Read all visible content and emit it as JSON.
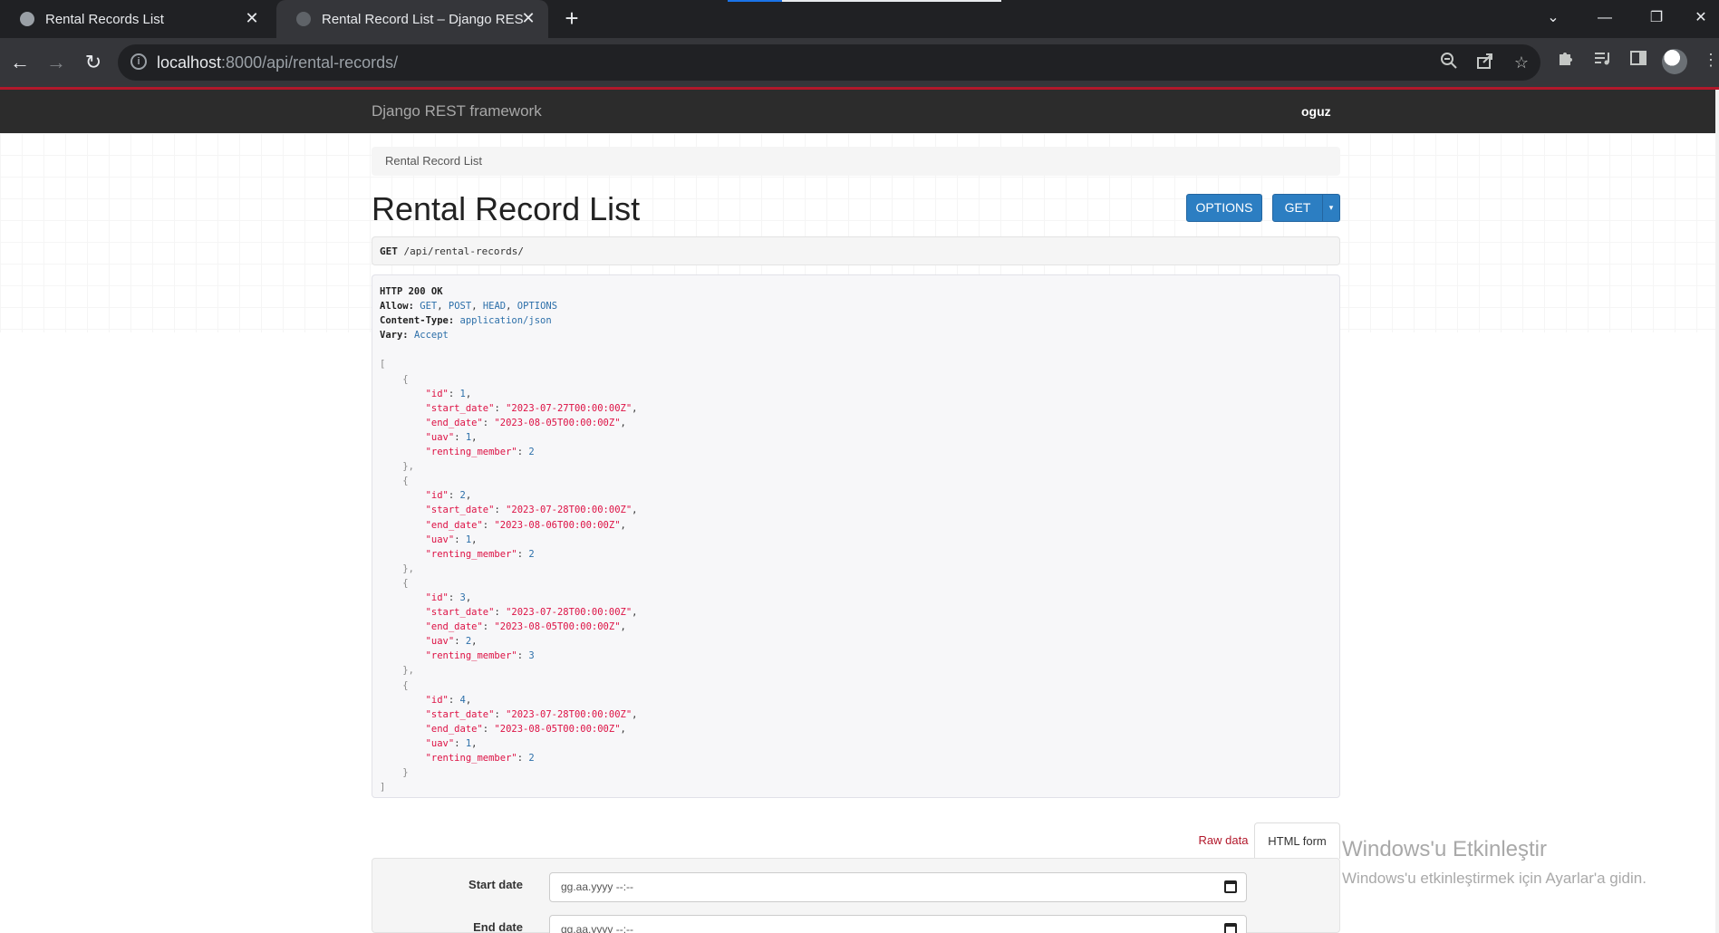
{
  "browser": {
    "tabs": [
      {
        "title": "Rental Records List",
        "active": false
      },
      {
        "title": "Rental Record List – Django REST",
        "active": true
      }
    ],
    "new_tab_label": "+",
    "url_host": "localhost",
    "url_rest": ":8000/api/rental-records/",
    "icons": {
      "back": "←",
      "forward": "→",
      "reload": "↻",
      "info": "i",
      "zoom": "zoom-out-icon",
      "share": "share-icon",
      "bookmark": "star-icon",
      "extensions": "puzzle-icon",
      "reading_list": "reading-list-icon",
      "side_panel": "side-panel-icon",
      "menu": "⋮"
    },
    "window_controls": {
      "tab_search": "⌄",
      "minimize": "—",
      "restore": "❐",
      "close": "✕"
    }
  },
  "navbar": {
    "brand": "Django REST framework",
    "user": "oguz"
  },
  "breadcrumb": "Rental Record List",
  "page_title": "Rental Record List",
  "buttons": {
    "options": "OPTIONS",
    "get": "GET",
    "get_caret": "▾"
  },
  "request": {
    "method": "GET",
    "path": "/api/rental-records/"
  },
  "response": {
    "status": "HTTP 200 OK",
    "headers": [
      {
        "key": "Allow",
        "value": "GET, POST, HEAD, OPTIONS"
      },
      {
        "key": "Content-Type",
        "value": "application/json"
      },
      {
        "key": "Vary",
        "value": "Accept"
      }
    ],
    "records": [
      {
        "id": 1,
        "start_date": "2023-07-27T00:00:00Z",
        "end_date": "2023-08-05T00:00:00Z",
        "uav": 1,
        "renting_member": 2
      },
      {
        "id": 2,
        "start_date": "2023-07-28T00:00:00Z",
        "end_date": "2023-08-06T00:00:00Z",
        "uav": 1,
        "renting_member": 2
      },
      {
        "id": 3,
        "start_date": "2023-07-28T00:00:00Z",
        "end_date": "2023-08-05T00:00:00Z",
        "uav": 2,
        "renting_member": 3
      },
      {
        "id": 4,
        "start_date": "2023-07-28T00:00:00Z",
        "end_date": "2023-08-05T00:00:00Z",
        "uav": 1,
        "renting_member": 2
      }
    ]
  },
  "form_tabs": {
    "raw": "Raw data",
    "html": "HTML form"
  },
  "form": {
    "fields": [
      {
        "label": "Start date",
        "placeholder": "gg.aa.yyyy --:--"
      },
      {
        "label": "End date",
        "placeholder": "gg.aa.yyyy --:--"
      }
    ]
  },
  "watermark": {
    "title": "Windows'u Etkinleştir",
    "subtitle": "Windows'u etkinleştirmek için Ayarlar'a gidin."
  },
  "colors": {
    "navbar_bg": "#2c2c2c",
    "accent_red": "#b2182b",
    "button_blue": "#2c7ec2",
    "json_string": "#dd1144",
    "json_number": "#2c6fa9"
  }
}
